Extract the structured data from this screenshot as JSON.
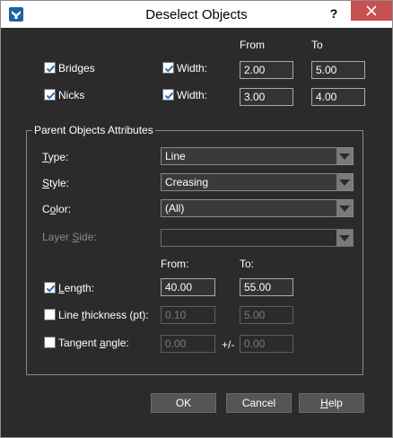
{
  "window": {
    "title": "Deselect Objects",
    "help_label": "?"
  },
  "top": {
    "from_header": "From",
    "to_header": "To",
    "rows": [
      {
        "label": "Bridges",
        "checked": true,
        "width_label": "Width:",
        "width_checked": true,
        "from": "2.00",
        "to": "5.00"
      },
      {
        "label": "Nicks",
        "checked": true,
        "width_label": "Width:",
        "width_checked": true,
        "from": "3.00",
        "to": "4.00"
      }
    ]
  },
  "parent": {
    "title": "Parent Objects Attributes",
    "type": {
      "label_pre": "",
      "label_ul": "T",
      "label_post": "ype:",
      "value": "Line"
    },
    "style": {
      "label_pre": "",
      "label_ul": "S",
      "label_post": "tyle:",
      "value": "Creasing"
    },
    "color": {
      "label_pre": "C",
      "label_ul": "o",
      "label_post": "lor:",
      "value": "(All)"
    },
    "layer_side": {
      "label_pre": "Layer ",
      "label_ul": "S",
      "label_post": "ide:",
      "value": ""
    },
    "from_header": "From:",
    "to_header": "To:",
    "length": {
      "label_pre": "",
      "label_ul": "L",
      "label_post": "ength:",
      "checked": true,
      "from": "40.00",
      "to": "55.00"
    },
    "line_thickness": {
      "label_pre": "Line ",
      "label_ul": "t",
      "label_post": "hickness (pt):",
      "checked": false,
      "from": "0.10",
      "to": "5.00"
    },
    "tangent_angle": {
      "label_pre": "Tangent ",
      "label_ul": "a",
      "label_post": "ngle:",
      "checked": false,
      "from": "0.00",
      "plusminus": "+/-",
      "to": "0.00"
    }
  },
  "buttons": {
    "ok": "OK",
    "cancel": "Cancel",
    "help_pre": "",
    "help_ul": "H",
    "help_post": "elp"
  },
  "colors": {
    "background": "#2b2b2b",
    "close_button": "#c75050",
    "app_icon": "#1f5fa6"
  }
}
